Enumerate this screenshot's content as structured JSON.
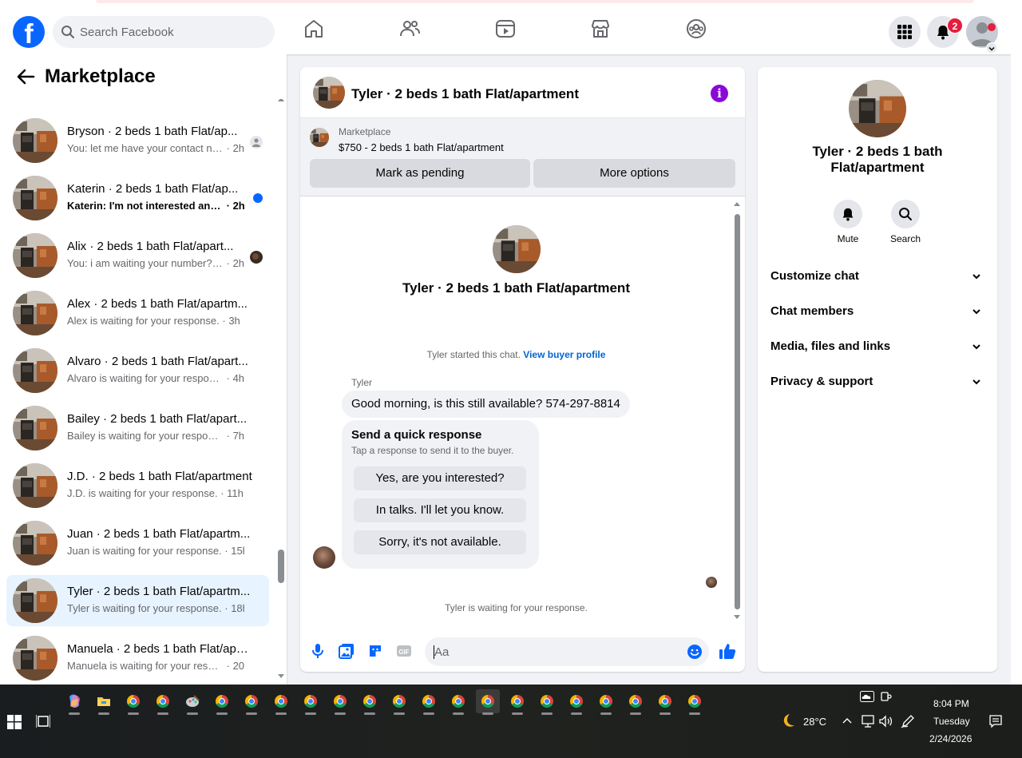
{
  "topnav": {
    "search_placeholder": "Search Facebook",
    "notification_count": "2",
    "brand_color": "#0866ff"
  },
  "sidebar": {
    "title": "Marketplace",
    "conversations": [
      {
        "title": "Bryson · 2 beds 1 bath Flat/ap...",
        "sub_text": "You: let me have your contact nu...",
        "time": "2h",
        "indicator": "seen-avatar-gray"
      },
      {
        "title": "Katerin · 2 beds 1 bath Flat/ap...",
        "sub_text": "Katerin: I'm not interested any...",
        "time": "2h",
        "indicator": "unread-dot",
        "unread": true
      },
      {
        "title": "Alix · 2 beds 1 bath Flat/apart...",
        "sub_text": "You: i am waiting your number? ...",
        "time": "2h",
        "indicator": "seen-avatar-photo"
      },
      {
        "title": "Alex · 2 beds 1 bath Flat/apartm...",
        "sub_text": "Alex is waiting for your response.",
        "time": "3h"
      },
      {
        "title": "Alvaro · 2 beds 1 bath Flat/apart...",
        "sub_text": "Alvaro is waiting for your response.",
        "time": "4h"
      },
      {
        "title": "Bailey · 2 beds 1 bath Flat/apart...",
        "sub_text": "Bailey is waiting for your response.",
        "time": "7h"
      },
      {
        "title": "J.D. · 2 beds 1 bath Flat/apartment",
        "sub_text": "J.D. is waiting for your response.",
        "time": "11h"
      },
      {
        "title": "Juan · 2 beds 1 bath Flat/apartm...",
        "sub_text": "Juan is waiting for your response.",
        "time": "15h"
      },
      {
        "title": "Tyler · 2 beds 1 bath Flat/apartm...",
        "sub_text": "Tyler is waiting for your response.",
        "time": "18h",
        "active": true
      },
      {
        "title": "Manuela · 2 beds 1 bath Flat/apa...",
        "sub_text": "Manuela is waiting for your respo...",
        "time": "20h"
      }
    ]
  },
  "chat": {
    "header_title": "Tyler · 2 beds 1 bath Flat/apartment",
    "marketplace_label": "Marketplace",
    "listing": "$750 - 2 beds 1 bath Flat/apartment",
    "mark_pending_label": "Mark as pending",
    "more_options_label": "More options",
    "body_title": "Tyler · 2 beds 1 bath Flat/apartment",
    "started_text": "Tyler started this chat.",
    "view_profile_label": "View buyer profile",
    "sender_name": "Tyler",
    "message": "Good morning, is this still available? 574-297-8814",
    "quick_title": "Send a quick response",
    "quick_sub": "Tap a response to send it to the buyer.",
    "quick_replies": [
      "Yes, are you interested?",
      "In talks. I'll let you know.",
      "Sorry, it's not available."
    ],
    "waiting_text": "Tyler is waiting for your response.",
    "composer_placeholder": "Aa",
    "gif_label": "GIF",
    "accent_color": "#0866ff",
    "info_label": "i"
  },
  "right_panel": {
    "title": "Tyler · 2 beds 1 bath Flat/apartment",
    "mute_label": "Mute",
    "search_label": "Search",
    "sections": [
      "Customize chat",
      "Chat members",
      "Media, files and links",
      "Privacy & support"
    ]
  },
  "taskbar": {
    "temperature": "28°C",
    "time": "8:04 PM",
    "day": "Tuesday",
    "date": "2/24/2026"
  }
}
